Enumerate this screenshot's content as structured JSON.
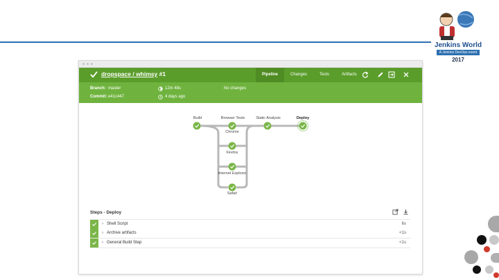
{
  "event_logo": {
    "title": "Jenkins World",
    "subtitle": "A Jenkins DevOps event",
    "year": "2017"
  },
  "run": {
    "project": "dropspace / whimsy",
    "number": "#1",
    "status": "success",
    "status_color": "#5a9d2b"
  },
  "tabs": [
    "Pipeline",
    "Changes",
    "Tests",
    "Artifacts"
  ],
  "active_tab": "Pipeline",
  "header_icons": [
    "replay-icon",
    "edit-icon",
    "open-classic-icon",
    "close-icon"
  ],
  "meta": {
    "branch_label": "Branch:",
    "branch": "master",
    "commit_label": "Commit:",
    "commit": "e41c447",
    "duration": "12m 48s",
    "started": "4 days ago",
    "changes": "No changes"
  },
  "pipeline": {
    "stages": [
      "Build",
      "Browser Tests",
      "Static Analysis",
      "Deploy"
    ],
    "parallel_branches": [
      "Chrome",
      "Firefox",
      "Internet Explorer",
      "Safari"
    ],
    "selected_stage": "Deploy"
  },
  "steps": {
    "title": "Steps - Deploy",
    "items": [
      {
        "name": "Shell Script",
        "duration": "6s"
      },
      {
        "name": "Archive artifacts",
        "duration": "<1s"
      },
      {
        "name": "General Build Step",
        "duration": "<1s"
      }
    ]
  },
  "colors": {
    "accent_blue": "#2c6fb0",
    "header_green": "#5a9d2b",
    "meta_green": "#6fb33e",
    "success_green": "#7ab648"
  }
}
